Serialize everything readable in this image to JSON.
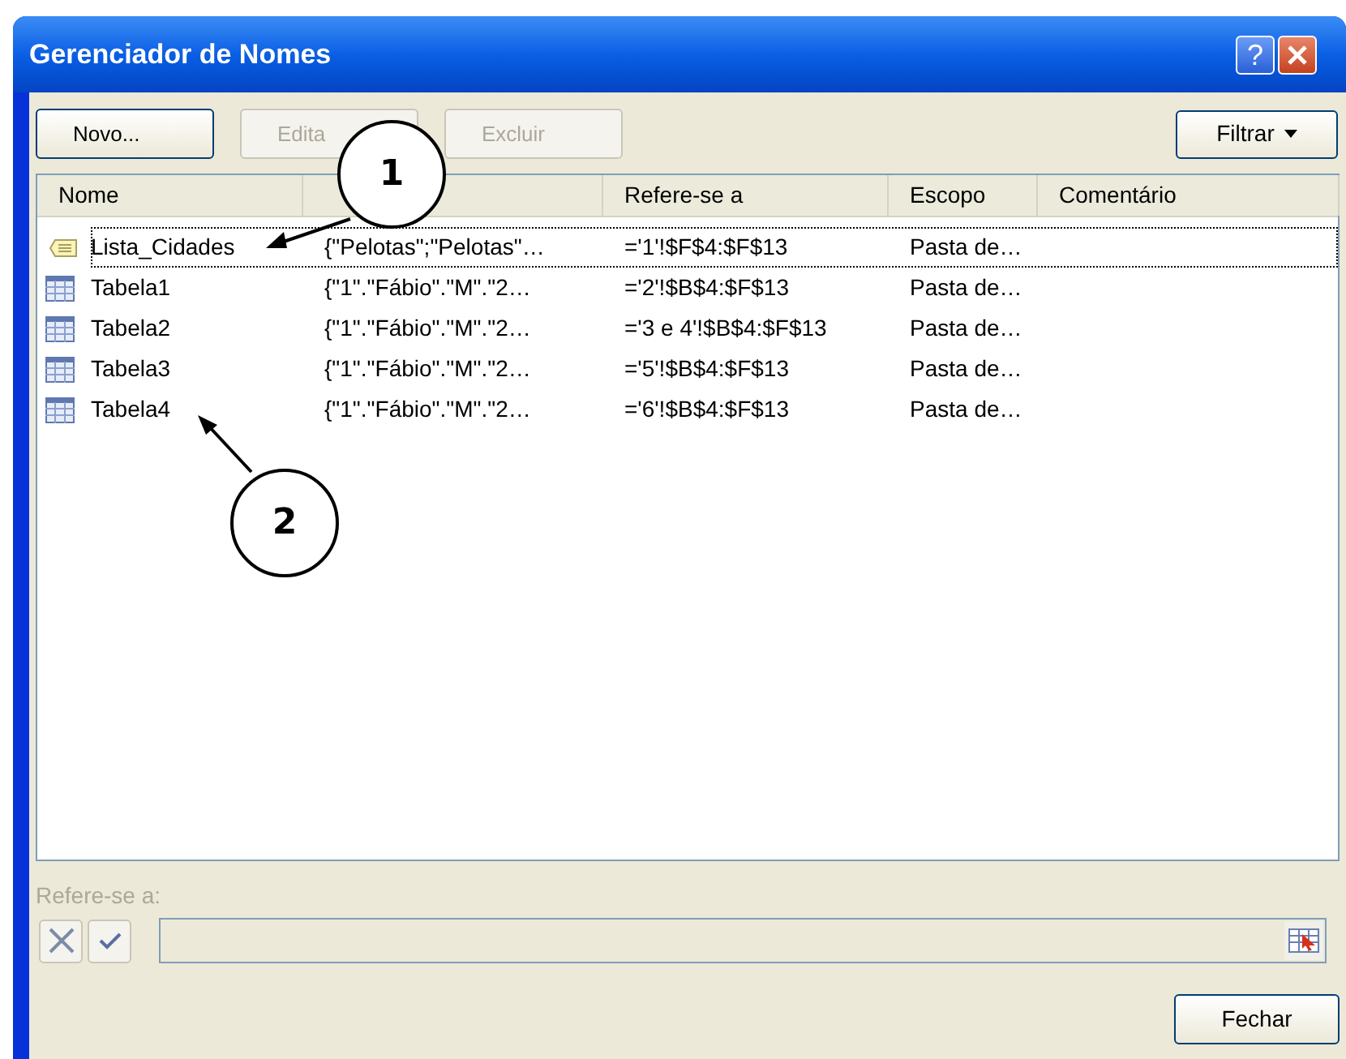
{
  "window": {
    "title": "Gerenciador de Nomes"
  },
  "title_buttons": [
    {
      "kind": "help",
      "label": "?"
    },
    {
      "kind": "close"
    }
  ],
  "toolbar": [
    {
      "label": "Novo...",
      "disabled": false
    },
    {
      "label": "Edita",
      "disabled": true
    },
    {
      "label": "Excluir",
      "disabled": true
    }
  ],
  "filter_button": {
    "label": "Filtrar"
  },
  "table": {
    "columns": [
      "Nome",
      null,
      "Refere-se a",
      "Escopo",
      "Comentário"
    ],
    "rows": [
      {
        "kind": "constant",
        "selected": true,
        "cells": [
          "Lista_Cidades",
          "{\"Pelotas\";\"Pelotas\"…",
          "='1'!$F$4:$F$13",
          "Pasta de…"
        ]
      },
      {
        "kind": "table",
        "selected": false,
        "cells": [
          "Tabela1",
          "{\"1\".\"Fábio\".\"M\".\"2…",
          "='2'!$B$4:$F$13",
          "Pasta de…"
        ]
      },
      {
        "kind": "table",
        "selected": false,
        "cells": [
          "Tabela2",
          "{\"1\".\"Fábio\".\"M\".\"2…",
          "='3 e 4'!$B$4:$F$13",
          "Pasta de…"
        ]
      },
      {
        "kind": "table",
        "selected": false,
        "cells": [
          "Tabela3",
          "{\"1\".\"Fábio\".\"M\".\"2…",
          "='5'!$B$4:$F$13",
          "Pasta de…"
        ]
      },
      {
        "kind": "table",
        "selected": false,
        "cells": [
          "Tabela4",
          "{\"1\".\"Fábio\".\"M\".\"2…",
          "='6'!$B$4:$F$13",
          "Pasta de…"
        ]
      }
    ]
  },
  "refers_to": {
    "label": "Refere-se a:"
  },
  "close_button": {
    "label": "Fechar"
  },
  "callouts": [
    "1",
    "2"
  ]
}
